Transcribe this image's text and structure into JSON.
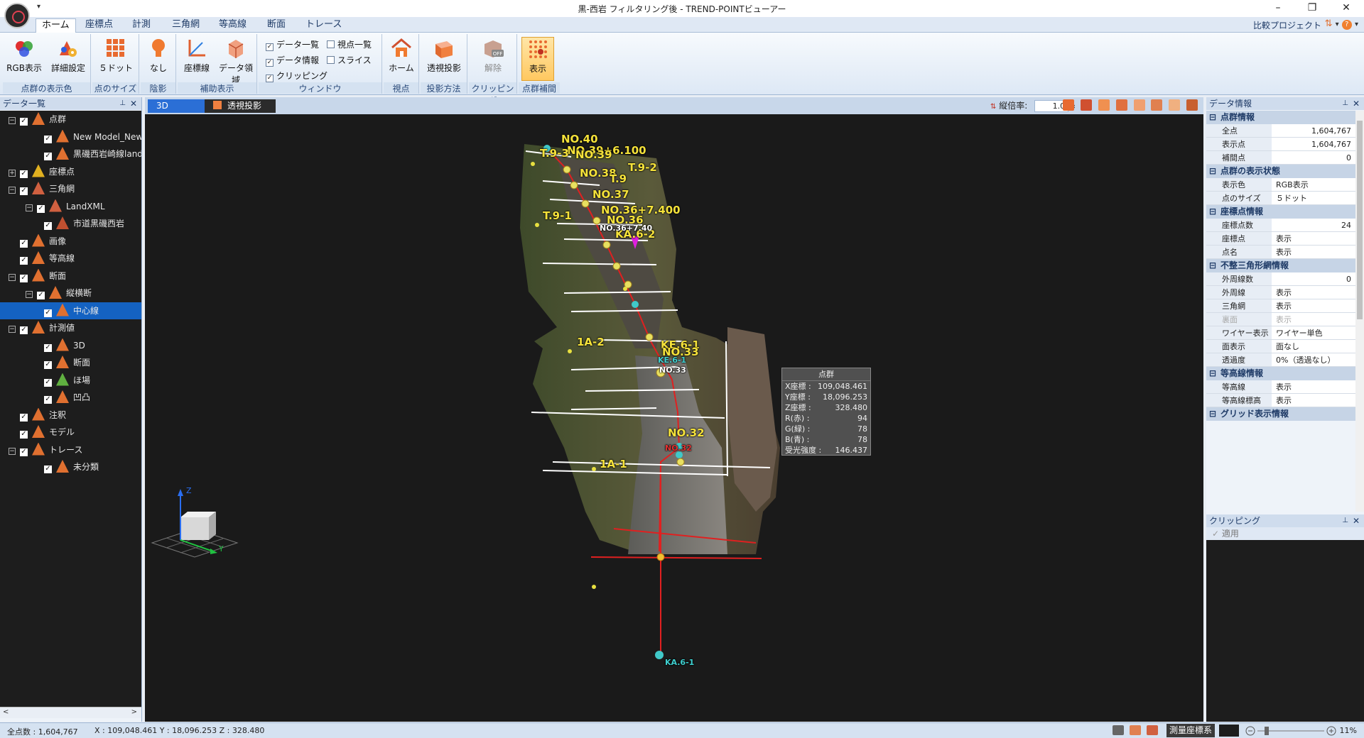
{
  "window": {
    "title": "黒-西岩 フィルタリング後 - TREND-POINTビューアー",
    "minimize": "–",
    "maximize": "❐",
    "close": "✕",
    "qa_arrow": "▾"
  },
  "ribbon_tabs": [
    "ホーム",
    "座標点",
    "計測",
    "三角網",
    "等高線",
    "断面",
    "トレース"
  ],
  "compare_project": "比較プロジェクト",
  "ribbon": {
    "groups": [
      {
        "label": "点群の表示色",
        "buttons": [
          "RGB表示",
          "詳細設定"
        ]
      },
      {
        "label": "点のサイズ",
        "buttons": [
          "５ドット"
        ]
      },
      {
        "label": "陰影",
        "buttons": [
          "なし"
        ]
      },
      {
        "label": "補助表示",
        "buttons": [
          "座標線",
          "データ領域"
        ]
      },
      {
        "label": "ウィンドウ",
        "checks": [
          {
            "label": "データ一覧",
            "checked": true
          },
          {
            "label": "データ情報",
            "checked": true
          },
          {
            "label": "クリッピング",
            "checked": true
          },
          {
            "label": "視点一覧",
            "checked": false
          },
          {
            "label": "スライス",
            "checked": false
          }
        ]
      },
      {
        "label": "視点",
        "buttons": [
          "ホーム"
        ]
      },
      {
        "label": "投影方法",
        "buttons": [
          "透視投影"
        ]
      },
      {
        "label": "クリッピング",
        "buttons": [
          "解除"
        ]
      },
      {
        "label": "点群補間",
        "buttons": [
          "表示"
        ]
      }
    ],
    "off_badge": "OFF"
  },
  "data_list": {
    "title": "データ一覧",
    "pin": "⊥",
    "close": "✕",
    "scroll_left": "<",
    "scroll_right": ">",
    "nodes": [
      {
        "label": "点群",
        "level": 0,
        "expander": "−",
        "icon": "point-cloud-icon",
        "color": "#e07030"
      },
      {
        "label": "New Model_New C",
        "level": 2,
        "expander": "",
        "icon": "point-cloud-data-icon",
        "color": "#e07030"
      },
      {
        "label": "黒磯西岩崎線land",
        "level": 2,
        "expander": "",
        "icon": "point-cloud-data-icon",
        "color": "#e07030"
      },
      {
        "label": "座標点",
        "level": 0,
        "expander": "+",
        "icon": "coordinate-point-icon",
        "color": "#e0b020"
      },
      {
        "label": "三角網",
        "level": 0,
        "expander": "−",
        "icon": "triangle-mesh-icon",
        "color": "#d06040"
      },
      {
        "label": "LandXML",
        "level": 1,
        "expander": "−",
        "icon": "landxml-icon",
        "color": "#d06040"
      },
      {
        "label": "市道黒磯西岩",
        "level": 2,
        "expander": "",
        "icon": "mesh-data-icon",
        "color": "#c05030"
      },
      {
        "label": "画像",
        "level": 0,
        "expander": "",
        "icon": "image-icon",
        "color": "#e07030"
      },
      {
        "label": "等高線",
        "level": 0,
        "expander": "",
        "icon": "contour-icon",
        "color": "#e07030"
      },
      {
        "label": "断面",
        "level": 0,
        "expander": "−",
        "icon": "section-icon",
        "color": "#e07030"
      },
      {
        "label": "縦横断",
        "level": 1,
        "expander": "−",
        "icon": "profile-icon",
        "color": "#e07030"
      },
      {
        "label": "中心線",
        "level": 2,
        "expander": "",
        "icon": "centerline-icon",
        "color": "#e07030",
        "selected": true
      },
      {
        "label": "計測値",
        "level": 0,
        "expander": "−",
        "icon": "measurement-icon",
        "color": "#e07030"
      },
      {
        "label": "3D",
        "level": 2,
        "expander": "",
        "icon": "measure-3d-icon",
        "color": "#e07030"
      },
      {
        "label": "断面",
        "level": 2,
        "expander": "",
        "icon": "measure-section-icon",
        "color": "#e07030"
      },
      {
        "label": "ほ場",
        "level": 2,
        "expander": "",
        "icon": "field-icon",
        "color": "#60b040"
      },
      {
        "label": "凹凸",
        "level": 2,
        "expander": "",
        "icon": "unevenness-icon",
        "color": "#e07030"
      },
      {
        "label": "注釈",
        "level": 0,
        "expander": "",
        "icon": "annotation-icon",
        "color": "#e07030"
      },
      {
        "label": "モデル",
        "level": 0,
        "expander": "",
        "icon": "model-icon",
        "color": "#e07030"
      },
      {
        "label": "トレース",
        "level": 0,
        "expander": "−",
        "icon": "trace-icon",
        "color": "#e07030"
      },
      {
        "label": "未分類",
        "level": 2,
        "expander": "",
        "icon": "unclassified-icon",
        "color": "#e07030"
      }
    ]
  },
  "view": {
    "tab_3d": "3D",
    "tab_persp": "透視投影",
    "vertical_scale_label": "縦倍率:",
    "vertical_scale_value": "1.0",
    "axis": {
      "z": "Z",
      "y": "Y"
    }
  },
  "map_labels": [
    {
      "text": "NO.40",
      "style": "y"
    },
    {
      "text": "NO.39+6.100",
      "style": "y"
    },
    {
      "text": "T.9-3",
      "style": "y"
    },
    {
      "text": "NO.39",
      "style": "y"
    },
    {
      "text": "NO.38",
      "style": "y"
    },
    {
      "text": "T.9-2",
      "style": "y"
    },
    {
      "text": "T.9",
      "style": "y"
    },
    {
      "text": "NO.37",
      "style": "y"
    },
    {
      "text": "NO.36+7.400",
      "style": "y"
    },
    {
      "text": "T.9-1",
      "style": "y"
    },
    {
      "text": "NO.36",
      "style": "y"
    },
    {
      "text": "KA.6-2",
      "style": "y"
    },
    {
      "text": "NO.36+7.40",
      "style": "w"
    },
    {
      "text": "1A-2",
      "style": "y"
    },
    {
      "text": "KE.6-1",
      "style": "y"
    },
    {
      "text": "NO.33",
      "style": "y"
    },
    {
      "text": "KE.6-1",
      "style": "c"
    },
    {
      "text": "NO.33",
      "style": "w"
    },
    {
      "text": "NO.32",
      "style": "y"
    },
    {
      "text": "NO.32",
      "style": "r"
    },
    {
      "text": "1A-1",
      "style": "y"
    },
    {
      "text": "KA.6-1",
      "style": "c"
    }
  ],
  "tooltip": {
    "title": "点群",
    "rows": [
      {
        "k": "X座標 :",
        "v": "109,048.461"
      },
      {
        "k": "Y座標 :",
        "v": "18,096.253"
      },
      {
        "k": "Z座標 :",
        "v": "328.480"
      },
      {
        "k": "R(赤) :",
        "v": "94"
      },
      {
        "k": "G(緑) :",
        "v": "78"
      },
      {
        "k": "B(青) :",
        "v": "78"
      },
      {
        "k": "受光強度 :",
        "v": "146.437"
      }
    ]
  },
  "data_info": {
    "title": "データ情報",
    "sections": [
      {
        "title": "点群情報",
        "rows": [
          {
            "k": "全点",
            "v": "1,604,767",
            "num": true
          },
          {
            "k": "表示点",
            "v": "1,604,767",
            "num": true
          },
          {
            "k": "補間点",
            "v": "0",
            "num": true
          }
        ]
      },
      {
        "title": "点群の表示状態",
        "rows": [
          {
            "k": "表示色",
            "v": "RGB表示"
          },
          {
            "k": "点のサイズ",
            "v": "５ドット"
          }
        ]
      },
      {
        "title": "座標点情報",
        "rows": [
          {
            "k": "座標点数",
            "v": "24",
            "num": true
          },
          {
            "k": "座標点",
            "v": "表示"
          },
          {
            "k": "点名",
            "v": "表示"
          }
        ]
      },
      {
        "title": "不整三角形網情報",
        "rows": [
          {
            "k": "外周線数",
            "v": "0",
            "num": true
          },
          {
            "k": "外周線",
            "v": "表示"
          },
          {
            "k": "三角網",
            "v": "表示"
          },
          {
            "k": "裏面",
            "v": "表示",
            "dim": true
          },
          {
            "k": "ワイヤー表示",
            "v": "ワイヤー単色"
          },
          {
            "k": "面表示",
            "v": "面なし"
          },
          {
            "k": "透過度",
            "v": "0%（透過なし）"
          }
        ]
      },
      {
        "title": "等高線情報",
        "rows": [
          {
            "k": "等高線",
            "v": "表示"
          },
          {
            "k": "等高線標高",
            "v": "表示"
          }
        ]
      },
      {
        "title": "グリッド表示情報",
        "rows": []
      }
    ]
  },
  "clipping": {
    "title": "クリッピング",
    "apply": "適用"
  },
  "status": {
    "point_count": "全点数 : 1,604,767",
    "coords": "X : 109,048.461  Y : 18,096.253  Z : 328.480",
    "crs": "測量座標系",
    "zoom": "11%"
  }
}
